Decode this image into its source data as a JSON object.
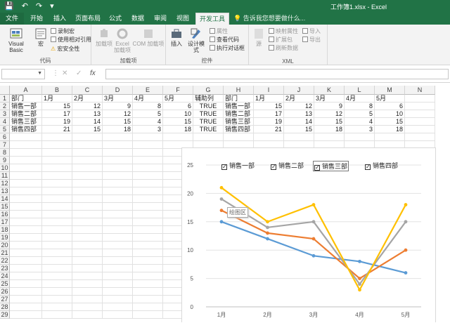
{
  "qat": {
    "save": "💾",
    "undo": "↶",
    "redo": "↷",
    "customize": "▾"
  },
  "title": "工作簿1.xlsx - Excel",
  "tabs": [
    {
      "label": "文件"
    },
    {
      "label": "开始"
    },
    {
      "label": "插入"
    },
    {
      "label": "页面布局"
    },
    {
      "label": "公式"
    },
    {
      "label": "数据"
    },
    {
      "label": "审阅"
    },
    {
      "label": "视图"
    },
    {
      "label": "开发工具"
    }
  ],
  "tell_me": "告诉我您想要做什么...",
  "ribbon": {
    "code": {
      "vb": "Visual Basic",
      "macro": "宏",
      "record": "录制宏",
      "relative": "使用相对引用",
      "security": "宏安全性",
      "group": "代码"
    },
    "addins": {
      "addin": "加载项",
      "excel": "Excel 加载项",
      "com": "COM 加载项",
      "group": "加载项"
    },
    "controls": {
      "insert": "插入",
      "design": "设计模式",
      "props": "属性",
      "viewcode": "查看代码",
      "dialog": "执行对话框",
      "group": "控件"
    },
    "xml": {
      "source": "源",
      "map": "映射属性",
      "pack": "扩展包",
      "refresh": "刷新数据",
      "import": "导入",
      "export": "导出",
      "group": "XML"
    }
  },
  "formula_bar": {
    "name_box": "",
    "formula": "",
    "cancel": "✕",
    "enter": "✓",
    "fx": "fx"
  },
  "columns": [
    "A",
    "B",
    "C",
    "D",
    "E",
    "F",
    "G",
    "H",
    "I",
    "J",
    "K",
    "L",
    "M",
    "N"
  ],
  "rows": [
    "1",
    "2",
    "3",
    "4",
    "5",
    "6",
    "7",
    "8",
    "9",
    "10",
    "11",
    "12",
    "13",
    "14",
    "15",
    "16",
    "17",
    "18",
    "19",
    "20",
    "21",
    "22",
    "23",
    "24",
    "25",
    "26",
    "27",
    "28",
    "29"
  ],
  "table": [
    [
      "部门",
      "1月",
      "2月",
      "3月",
      "4月",
      "5月",
      "辅助列",
      "部门",
      "1月",
      "2月",
      "3月",
      "4月",
      "5月"
    ],
    [
      "销售一部",
      "15",
      "12",
      "9",
      "8",
      "6",
      "TRUE",
      "销售一部",
      "15",
      "12",
      "9",
      "8",
      "6"
    ],
    [
      "销售二部",
      "17",
      "13",
      "12",
      "5",
      "10",
      "TRUE",
      "销售二部",
      "17",
      "13",
      "12",
      "5",
      "10"
    ],
    [
      "销售三部",
      "19",
      "14",
      "15",
      "4",
      "15",
      "TRUE",
      "销售三部",
      "19",
      "14",
      "15",
      "4",
      "15"
    ],
    [
      "销售四部",
      "21",
      "15",
      "18",
      "3",
      "18",
      "TRUE",
      "销售四部",
      "21",
      "15",
      "18",
      "3",
      "18"
    ]
  ],
  "chart_data": {
    "type": "line",
    "categories": [
      "1月",
      "2月",
      "3月",
      "4月",
      "5月"
    ],
    "series": [
      {
        "name": "销售一部",
        "values": [
          15,
          12,
          9,
          8,
          6
        ],
        "color": "#5b9bd5",
        "checked": true
      },
      {
        "name": "销售二部",
        "values": [
          17,
          13,
          12,
          5,
          10
        ],
        "color": "#ed7d31",
        "checked": true
      },
      {
        "name": "销售三部",
        "values": [
          19,
          14,
          15,
          4,
          15
        ],
        "color": "#a5a5a5",
        "checked": true
      },
      {
        "name": "销售四部",
        "values": [
          21,
          15,
          18,
          3,
          18
        ],
        "color": "#ffc000",
        "checked": true
      }
    ],
    "ylim": [
      0,
      25
    ],
    "yticks": [
      "0",
      "5",
      "10",
      "15",
      "20",
      "25"
    ],
    "grid": true,
    "legend": "top",
    "tooltip": "绘图区"
  }
}
